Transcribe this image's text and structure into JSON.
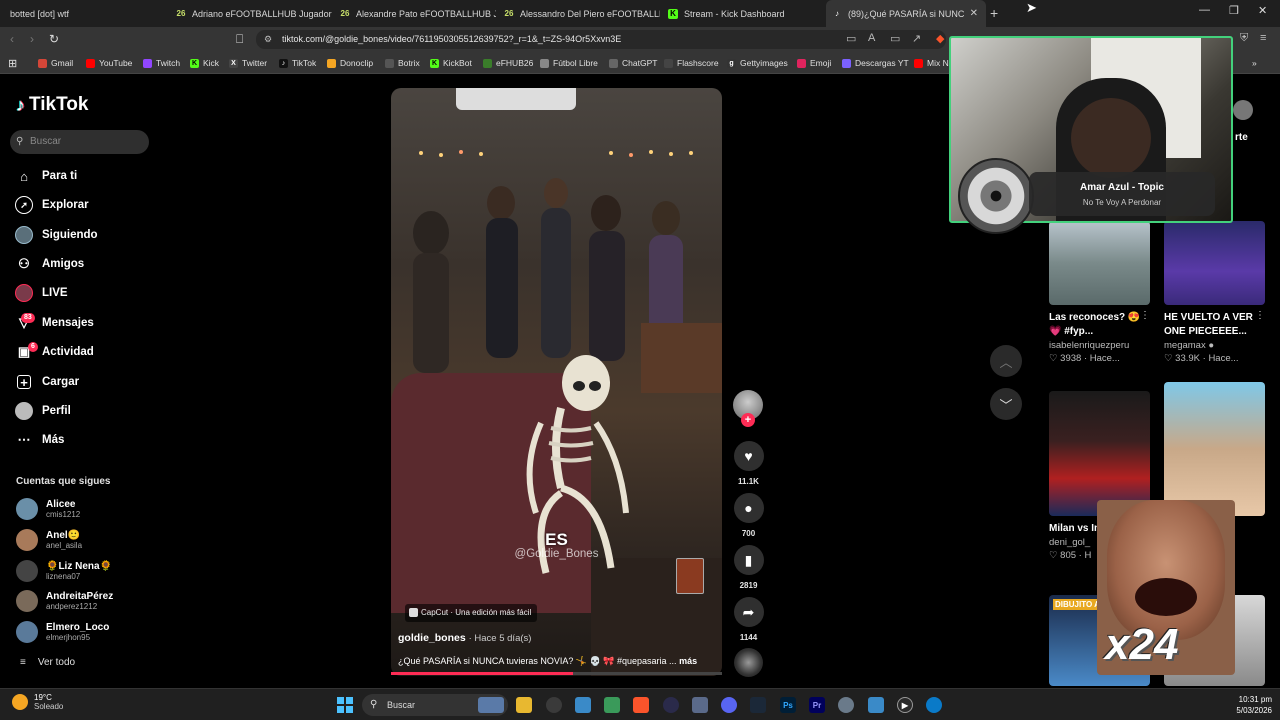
{
  "tabs": [
    {
      "label": "botted [dot] wtf",
      "active": false
    },
    {
      "label": "Adriano eFOOTBALLHUB Jugadores",
      "active": false
    },
    {
      "label": "Alexandre Pato eFOOTBALLHUB Juga",
      "active": false
    },
    {
      "label": "Alessandro Del Piero eFOOTBALLHUB",
      "active": false
    },
    {
      "label": "Stream - Kick Dashboard",
      "active": false
    },
    {
      "label": "(89)¿Qué PASARÍA si NUNCA",
      "active": true
    }
  ],
  "tab_fav_26": "26",
  "new_tab": "+",
  "address": {
    "url": "tiktok.com/@goldie_bones/video/7611950305512639752?_r=1&_t=ZS-94Or5Xxvn3E"
  },
  "bookmarks": [
    {
      "label": "Gmail",
      "color": "#d44638"
    },
    {
      "label": "YouTube",
      "color": "#ff0000"
    },
    {
      "label": "Twitch",
      "color": "#9146ff"
    },
    {
      "label": "Kick",
      "color": "#53fc18"
    },
    {
      "label": "Twitter",
      "color": "#444444"
    },
    {
      "label": "TikTok",
      "color": "#111111"
    },
    {
      "label": "Donoclip",
      "color": "#f5a623"
    },
    {
      "label": "Botrix",
      "color": "#555555"
    },
    {
      "label": "KickBot",
      "color": "#53fc18"
    },
    {
      "label": "eFHUB26",
      "color": "#3a7d2a"
    },
    {
      "label": "Fútbol Libre",
      "color": "#888888"
    },
    {
      "label": "ChatGPT",
      "color": "#666666"
    },
    {
      "label": "Flashscore",
      "color": "#444444"
    },
    {
      "label": "Gettyimages",
      "color": "#333333"
    },
    {
      "label": "Emoji",
      "color": "#e0245e"
    },
    {
      "label": "Descargas YT",
      "color": "#7b61ff"
    },
    {
      "label": "Mix N",
      "color": "#ff0000"
    }
  ],
  "tiktok": {
    "logo": "TikTok",
    "search_placeholder": "Buscar",
    "nav": [
      {
        "label": "Para ti",
        "icon": "home-icon"
      },
      {
        "label": "Explorar",
        "icon": "compass-icon"
      },
      {
        "label": "Siguiendo",
        "icon": "following-icon"
      },
      {
        "label": "Amigos",
        "icon": "friends-icon"
      },
      {
        "label": "LIVE",
        "icon": "live-icon"
      },
      {
        "label": "Mensajes",
        "icon": "messages-icon",
        "badge": "83"
      },
      {
        "label": "Actividad",
        "icon": "activity-icon",
        "badge": "6"
      },
      {
        "label": "Cargar",
        "icon": "upload-icon"
      },
      {
        "label": "Perfil",
        "icon": "profile-icon"
      },
      {
        "label": "Más",
        "icon": "more-icon"
      }
    ],
    "follows_title": "Cuentas que sigues",
    "follows": [
      {
        "name": "Alicee",
        "handle": "cmis1212",
        "color": "#6a8fa8"
      },
      {
        "name": "Anel🙂",
        "handle": "anel_asila",
        "color": "#a87a5a"
      },
      {
        "name": "🌻Liz Nena🌻",
        "handle": "liznena07",
        "color": "#444444"
      },
      {
        "name": "AndreitaPérez",
        "handle": "andperez1212",
        "color": "#7a6a5a"
      },
      {
        "name": "Elmero_Loco",
        "handle": "elmerjhon95",
        "color": "#5a7a9a"
      }
    ],
    "ver_mas": "Ver todo"
  },
  "video": {
    "caption_word": "ES",
    "watermark": "@Goldie_Bones",
    "capcut": "CapCut · Una edición más fácil",
    "author": "goldie_bones",
    "time": "· Hace 5 día(s)",
    "description": "¿Qué PASARÍA si NUNCA tuvieras NOVIA? 🤸 💀 🎀 #quepasaria ...",
    "more": "más",
    "progress": 0.55,
    "likes": "11.1K",
    "comments": "700",
    "saves": "2819",
    "shares": "1144"
  },
  "right_cards": [
    {
      "title": "Las reconoces? 😍💗 #fyp...",
      "author": "isabelenriquezperu",
      "likes": "3938 · Hace..."
    },
    {
      "title": "HE VUELTO A VER ONE PIECEEEE...",
      "author": "megamax ●",
      "likes": "33.9K · Hace..."
    },
    {
      "title": "Milan vs In 2008",
      "author": "deni_gol_",
      "likes": "805 · H"
    },
    {
      "title": "",
      "author": "",
      "likes": ""
    }
  ],
  "right_header": "rte",
  "right_thumb_text": "DIBUJITO AL CI",
  "overlay": {
    "song": "Amar Azul - Topic",
    "track": "No Te Voy A Perdonar",
    "emote_text": "x24"
  },
  "taskbar": {
    "temp": "19°C",
    "condition": "Soleado",
    "search": "Buscar",
    "time": "10:31 pm",
    "date": "5/03/2026"
  }
}
